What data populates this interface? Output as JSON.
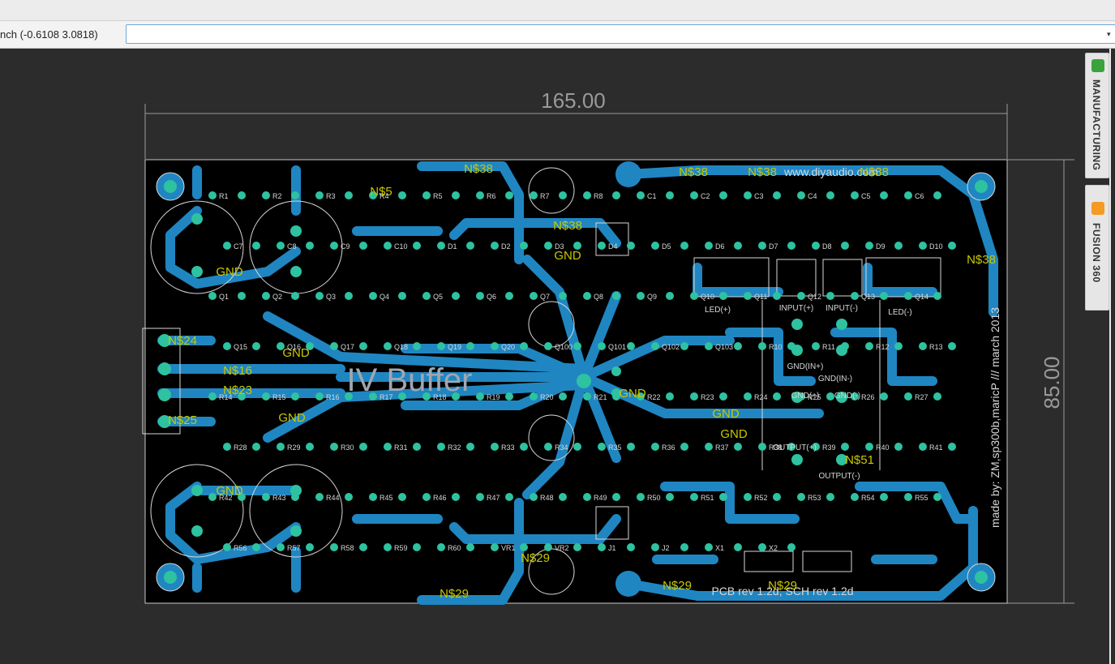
{
  "app": {
    "coordinate_readout": "nch (-0.6108 3.0818)",
    "command_input_value": "",
    "dropdown_arrow": "▾"
  },
  "side_panels": [
    {
      "label": "MANUFACTURING",
      "icon": "manufacturing-icon",
      "icon_color": "#3aa33a"
    },
    {
      "label": "FUSION 360",
      "icon": "fusion-icon",
      "icon_color": "#f59a23"
    }
  ],
  "board": {
    "width_dimension": "165.00",
    "height_dimension": "85.00",
    "title": "IV Buffer",
    "top_label": "www.diyaudio.com",
    "revision": "PCB rev 1.2d, SCH rev 1.2d",
    "credit": "made by: ZM,sp300b,maricP /// march 2013",
    "colors": {
      "copper": "#1f86c2",
      "pad": "#2ec2a0",
      "silk": "#d8d8d8",
      "label": "#c8c800",
      "board_bg": "#000000",
      "outline": "#c8c8c8"
    },
    "net_labels": [
      "N$38",
      "N$38",
      "N$38",
      "N$38",
      "N$38",
      "N$38",
      "N$29",
      "N$29",
      "N$29",
      "N$29",
      "N$5",
      "N$16",
      "N$23",
      "N$24",
      "N$25",
      "N$51",
      "GND",
      "GND",
      "GND",
      "GND",
      "GND",
      "GND",
      "GND",
      "GND"
    ],
    "components": [
      "R1",
      "R2",
      "R3",
      "R4",
      "R5",
      "R6",
      "R7",
      "R8",
      "C1",
      "C2",
      "C3",
      "C4",
      "C5",
      "C6",
      "C7",
      "C8",
      "C9",
      "C10",
      "D1",
      "D2",
      "D3",
      "D4",
      "D5",
      "D6",
      "D7",
      "D8",
      "D9",
      "D10",
      "Q1",
      "Q2",
      "Q3",
      "Q4",
      "Q5",
      "Q6",
      "Q7",
      "Q8",
      "Q9",
      "Q10",
      "Q11",
      "Q12",
      "Q13",
      "Q14",
      "Q15",
      "Q16",
      "Q17",
      "Q18",
      "Q19",
      "Q20",
      "Q100",
      "Q101",
      "Q102",
      "Q103",
      "R10",
      "R11",
      "R12",
      "R13",
      "R14",
      "R15",
      "R16",
      "R17",
      "R18",
      "R19",
      "R20",
      "R21",
      "R22",
      "R23",
      "R24",
      "R25",
      "R26",
      "R27",
      "R28",
      "R29",
      "R30",
      "R31",
      "R32",
      "R33",
      "R34",
      "R35",
      "R36",
      "R37",
      "R38",
      "R39",
      "R40",
      "R41",
      "R42",
      "R43",
      "R44",
      "R45",
      "R46",
      "R47",
      "R48",
      "R49",
      "R50",
      "R51",
      "R52",
      "R53",
      "R54",
      "R55",
      "R56",
      "R57",
      "R58",
      "R59",
      "R60",
      "VR1",
      "VR2",
      "J1",
      "J2",
      "X1",
      "X2"
    ],
    "pin_labels": [
      "INPUT(+)",
      "INPUT(-)",
      "GND(IN+)",
      "GND(IN-)",
      "GND(+)",
      "GND(-)",
      "OUTPUT(+)",
      "OUTPUT(-)",
      "LED(+)",
      "LED(-)"
    ]
  }
}
